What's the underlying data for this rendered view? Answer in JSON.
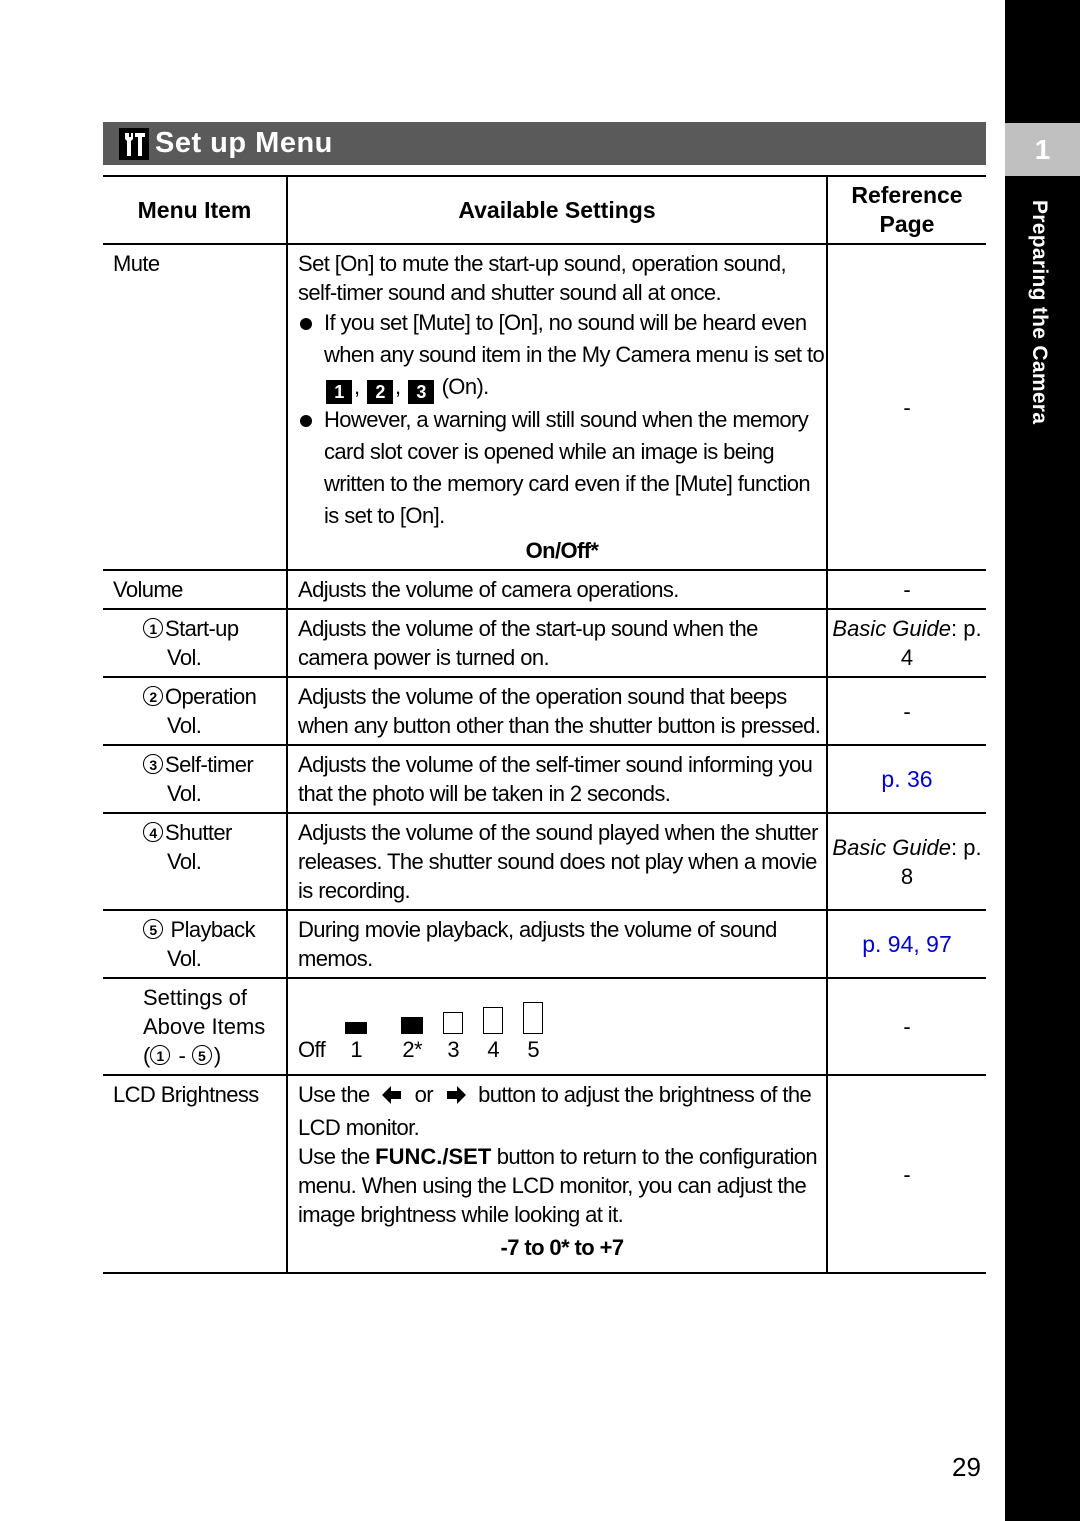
{
  "section": {
    "icon": "wrench-icon",
    "title": "Set up Menu"
  },
  "sidebar": {
    "chapter_number": "1",
    "chapter_title": "Preparing the Camera"
  },
  "table": {
    "headers": [
      "Menu Item",
      "Available Settings",
      "Reference Page"
    ],
    "mute": {
      "item": "Mute",
      "description": "Set [On] to mute the start-up sound, operation sound, self-timer sound and shutter sound all at once.",
      "bullet1_a": "If you set [Mute] to [On], no sound will be heard even when any sound item in the My Camera menu is set to",
      "bullet1_icons": [
        "1",
        "2",
        "3"
      ],
      "bullet1_b": "(On).",
      "bullet2": "However, a warning will still sound when the memory card slot cover is opened while an image is being written to the memory card even if the [Mute] function is set to [On].",
      "setting": "On/Off*",
      "ref": "-"
    },
    "volume": {
      "item": "Volume",
      "description": "Adjusts the volume of camera operations.",
      "ref": "-"
    },
    "subitems": [
      {
        "num": "1",
        "label_a": "Start-up",
        "label_b": "Vol.",
        "description": "Adjusts the volume of the start-up sound when the camera power is turned on.",
        "ref_italic": "Basic Guide",
        "ref_page": ": p. 4"
      },
      {
        "num": "2",
        "label_a": "Operation",
        "label_b": "Vol.",
        "description": "Adjusts the volume of the operation sound that beeps when any button other than the shutter button is pressed.",
        "ref": "-"
      },
      {
        "num": "3",
        "label_a": "Self-timer",
        "label_b": "Vol.",
        "description": "Adjusts the volume of the self-timer sound informing you that the photo will be taken in 2 seconds.",
        "ref_link": "p. 36"
      },
      {
        "num": "4",
        "label_a": "Shutter",
        "label_b": "Vol.",
        "description": "Adjusts the volume of the sound played when the shutter releases. The shutter sound does not play when a movie is recording.",
        "ref_italic": "Basic Guide",
        "ref_page": ": p. 8"
      },
      {
        "num": "5",
        "label_a": "Playback",
        "label_b": "Vol.",
        "description": "During movie playback, adjusts the volume of sound memos.",
        "ref_link": "p. 94, 97"
      }
    ],
    "settings_above": {
      "label_a": "Settings of",
      "label_b": "Above Items",
      "range_open": "(",
      "range_sep": " - ",
      "range_close": ")",
      "range_from": "1",
      "range_to": "5",
      "levels": [
        "Off",
        "1",
        "2*",
        "3",
        "4",
        "5"
      ],
      "ref": "-"
    },
    "lcd": {
      "item": "LCD Brightness",
      "line1_a": "Use the",
      "line1_or": "or",
      "line1_b": "button to adjust the brightness of the LCD monitor.",
      "line2_a": "Use the",
      "line2_bold": "FUNC./SET",
      "line2_b": "button to return to the configuration menu. When using the LCD monitor, you can adjust the image brightness while looking at it.",
      "setting": "-7 to 0* to +7",
      "ref": "-"
    }
  },
  "page_number": "29"
}
